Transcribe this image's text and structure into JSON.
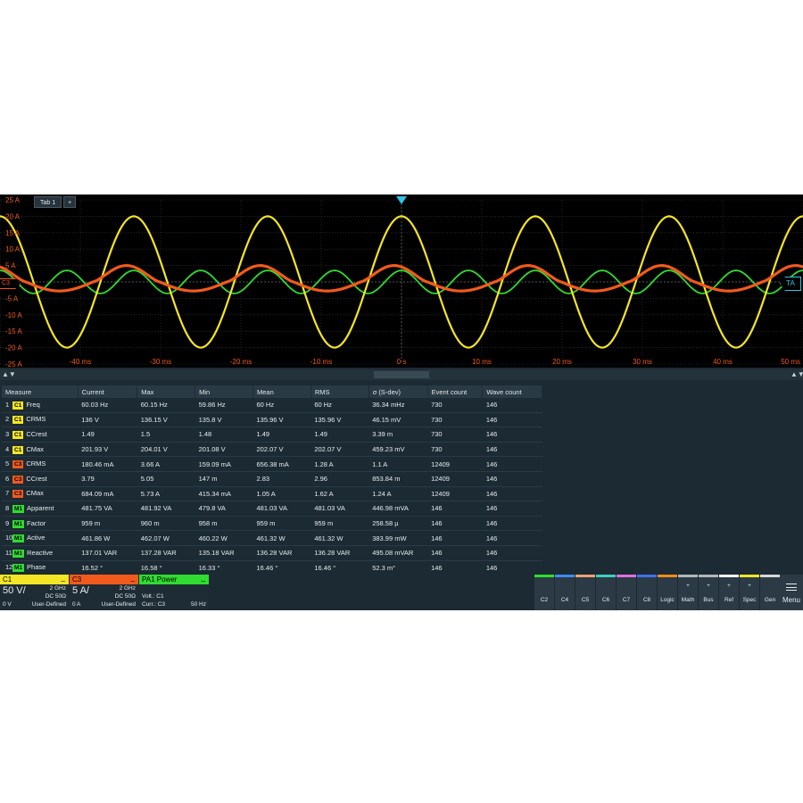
{
  "tab": {
    "label": "Tab 1",
    "add_label": "+"
  },
  "markers": {
    "c3": "C3",
    "trigger_area": "TA"
  },
  "axis": {
    "y_labels": [
      "25 A",
      "20 A",
      "15 A",
      "10 A",
      "5 A",
      "0 A",
      "-5 A",
      "-10 A",
      "-15 A",
      "-20 A",
      "-25 A"
    ],
    "x_labels": [
      "-40 ms",
      "-30 ms",
      "-20 ms",
      "-10 ms",
      "0 s",
      "10 ms",
      "20 ms",
      "30 ms",
      "40 ms",
      "50 ms"
    ]
  },
  "colors": {
    "c1": "#f5e625",
    "c3": "#f25a1c",
    "math": "#2fdc2f",
    "grid": "#3a3a3a",
    "trigger": "#2ec4e6"
  },
  "chart_data": {
    "type": "line",
    "x_unit": "ms",
    "y_unit": "A",
    "xlim": [
      -50,
      50
    ],
    "ylim": [
      -25,
      25
    ],
    "frequency_hz": 60,
    "series": [
      {
        "channel": "C1",
        "color": "#f5e625",
        "amplitude": 20
      },
      {
        "channel": "C3",
        "color": "#f25a1c",
        "amplitude": 5
      },
      {
        "channel": "M1",
        "color": "#2fdc2f",
        "amplitude": 3.5
      }
    ]
  },
  "scroll": {
    "up": "▲",
    "down": "▼"
  },
  "table": {
    "headers": [
      "Measure",
      "Current",
      "Max",
      "Min",
      "Mean",
      "RMS",
      "σ (S-dev)",
      "Event count",
      "Wave count"
    ],
    "rows": [
      {
        "num": "1",
        "src": "C1",
        "measure": "Freq",
        "current": "60.03 Hz",
        "max": "60.15 Hz",
        "min": "59.86 Hz",
        "mean": "60 Hz",
        "rms": "60 Hz",
        "sdev": "36.34 mHz",
        "event": "730",
        "wave": "146"
      },
      {
        "num": "2",
        "src": "C1",
        "measure": "CRMS",
        "current": "136 V",
        "max": "136.15 V",
        "min": "135.8 V",
        "mean": "135.96 V",
        "rms": "135.96 V",
        "sdev": "46.15 mV",
        "event": "730",
        "wave": "146"
      },
      {
        "num": "3",
        "src": "C1",
        "measure": "CCrest",
        "current": "1.49",
        "max": "1.5",
        "min": "1.48",
        "mean": "1.49",
        "rms": "1.49",
        "sdev": "3.39 m",
        "event": "730",
        "wave": "146"
      },
      {
        "num": "4",
        "src": "C1",
        "measure": "CMax",
        "current": "201.93 V",
        "max": "204.01 V",
        "min": "201.08 V",
        "mean": "202.07 V",
        "rms": "202.07 V",
        "sdev": "459.23 mV",
        "event": "730",
        "wave": "146"
      },
      {
        "num": "5",
        "src": "C3",
        "measure": "CRMS",
        "current": "180.46 mA",
        "max": "3.66 A",
        "min": "159.09 mA",
        "mean": "656.38 mA",
        "rms": "1.28 A",
        "sdev": "1.1 A",
        "event": "12409",
        "wave": "146"
      },
      {
        "num": "6",
        "src": "C3",
        "measure": "CCrest",
        "current": "3.79",
        "max": "5.05",
        "min": "147 m",
        "mean": "2.83",
        "rms": "2.96",
        "sdev": "853.84 m",
        "event": "12409",
        "wave": "146"
      },
      {
        "num": "7",
        "src": "C3",
        "measure": "CMax",
        "current": "684.09 mA",
        "max": "5.73 A",
        "min": "415.34 mA",
        "mean": "1.05 A",
        "rms": "1.62 A",
        "sdev": "1.24 A",
        "event": "12409",
        "wave": "146"
      },
      {
        "num": "8",
        "src": "M1",
        "measure": "Apparent",
        "current": "481.75 VA",
        "max": "481.92 VA",
        "min": "479.8 VA",
        "mean": "481.03 VA",
        "rms": "481.03 VA",
        "sdev": "446.98 mVA",
        "event": "146",
        "wave": "146"
      },
      {
        "num": "9",
        "src": "M1",
        "measure": "Factor",
        "current": "959 m",
        "max": "960 m",
        "min": "958 m",
        "mean": "959 m",
        "rms": "959 m",
        "sdev": "258.58 µ",
        "event": "146",
        "wave": "146"
      },
      {
        "num": "10",
        "src": "M1",
        "measure": "Active",
        "current": "461.86 W",
        "max": "462.07 W",
        "min": "460.22 W",
        "mean": "461.32 W",
        "rms": "461.32 W",
        "sdev": "383.99 mW",
        "event": "146",
        "wave": "146"
      },
      {
        "num": "11",
        "src": "M1",
        "measure": "Reactive",
        "current": "137.01 VAR",
        "max": "137.28 VAR",
        "min": "135.18 VAR",
        "mean": "136.28 VAR",
        "rms": "136.28 VAR",
        "sdev": "495.08 mVAR",
        "event": "146",
        "wave": "146"
      },
      {
        "num": "12",
        "src": "M1",
        "measure": "Phase",
        "current": "16.52 °",
        "max": "16.58 °",
        "min": "16.33 °",
        "mean": "16.46 °",
        "rms": "16.46 °",
        "sdev": "52.3 m°",
        "event": "146",
        "wave": "146"
      }
    ]
  },
  "channels": {
    "c1": {
      "name": "C1",
      "min": "_",
      "scale": "50 V/",
      "bw": "2 GHz",
      "coupling": "DC 50Ω",
      "offset": "0 V",
      "probe": "User-Defined"
    },
    "c3": {
      "name": "C3",
      "min": "_",
      "scale": "5 A/",
      "bw": "2 GHz",
      "coupling": "DC 50Ω",
      "offset": "0 A",
      "probe": "User-Defined"
    },
    "pa1": {
      "name": "PA1 Power",
      "min": "_",
      "volt": "Volt.: C1",
      "curr": "Curr.: C3",
      "freq": "50 Hz"
    }
  },
  "buttons": [
    {
      "label": "C2",
      "color": "#2fdc2f",
      "plus": ""
    },
    {
      "label": "C4",
      "color": "#3c8cf0",
      "plus": ""
    },
    {
      "label": "C5",
      "color": "#f0a070",
      "plus": ""
    },
    {
      "label": "C6",
      "color": "#3cd0c0",
      "plus": ""
    },
    {
      "label": "C7",
      "color": "#e070e0",
      "plus": ""
    },
    {
      "label": "C8",
      "color": "#4070f0",
      "plus": ""
    },
    {
      "label": "Logic",
      "color": "#f08c1c",
      "plus": ""
    },
    {
      "label": "Math",
      "color": "#b0b8bc",
      "plus": "+"
    },
    {
      "label": "Bus",
      "color": "#b0b8bc",
      "plus": "+"
    },
    {
      "label": "Ref",
      "color": "#ffffff",
      "plus": "+"
    },
    {
      "label": "Spec",
      "color": "#f5e625",
      "plus": "+"
    },
    {
      "label": "Gen",
      "color": "#d8d8d8",
      "plus": ""
    }
  ],
  "menu": {
    "label": "Menu"
  }
}
